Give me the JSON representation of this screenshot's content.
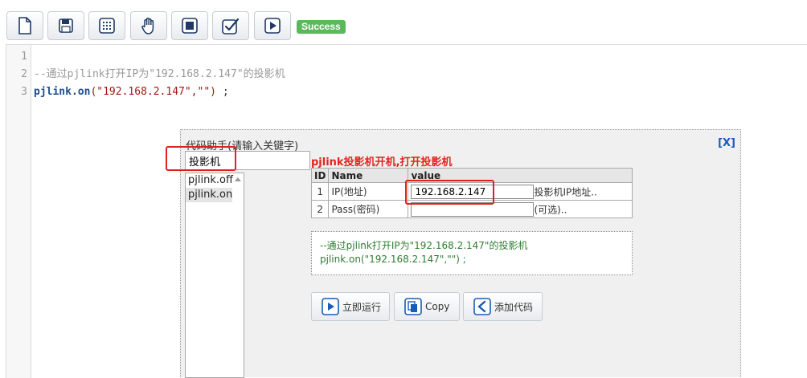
{
  "toolbar": {
    "buttons": [
      {
        "name": "new-file-button",
        "icon": "new-file-icon"
      },
      {
        "name": "save-button",
        "icon": "save-icon"
      },
      {
        "name": "grid-button",
        "icon": "grid-icon"
      },
      {
        "name": "hand-button",
        "icon": "hand-icon"
      },
      {
        "name": "stop-button",
        "icon": "stop-icon"
      },
      {
        "name": "check-button",
        "icon": "check-icon"
      },
      {
        "name": "run-button",
        "icon": "play-icon"
      }
    ],
    "status": "Success"
  },
  "editor": {
    "lines": [
      {
        "num": "1",
        "text": ""
      },
      {
        "num": "2",
        "text": "--通过pjlink打开IP为\"192.168.2.147\"的投影机"
      },
      {
        "num": "3",
        "fn": "pjlink.on",
        "args": "(\"192.168.2.147\",\"\")",
        "tail": " ;"
      }
    ]
  },
  "helper": {
    "title": "代码助手(请输入关键字)",
    "close_label": "[X]",
    "search_value": "投影机",
    "functions": [
      "pjlink.off",
      "pjlink.on"
    ],
    "selected_function": "pjlink.on",
    "description": "pjlink投影机开机,打开投影机",
    "table": {
      "headers": [
        "ID",
        "Name",
        "value"
      ],
      "rows": [
        {
          "id": "1",
          "name": "IP(地址)",
          "value": "192.168.2.147",
          "hint": "投影机IP地址.."
        },
        {
          "id": "2",
          "name": "Pass(密码)",
          "value": "",
          "hint": "(可选).."
        }
      ]
    },
    "preview": {
      "comment": "--通过pjlink打开IP为\"192.168.2.147\"的投影机",
      "code": "pjlink.on(\"192.168.2.147\",\"\") ;"
    },
    "actions": {
      "run_label": "立即运行",
      "copy_label": "Copy",
      "add_label": "添加代码"
    }
  },
  "colors": {
    "accent": "#1a5bb5",
    "success": "#5cb85c",
    "highlight": "#e02020",
    "description": "#e1251b"
  }
}
